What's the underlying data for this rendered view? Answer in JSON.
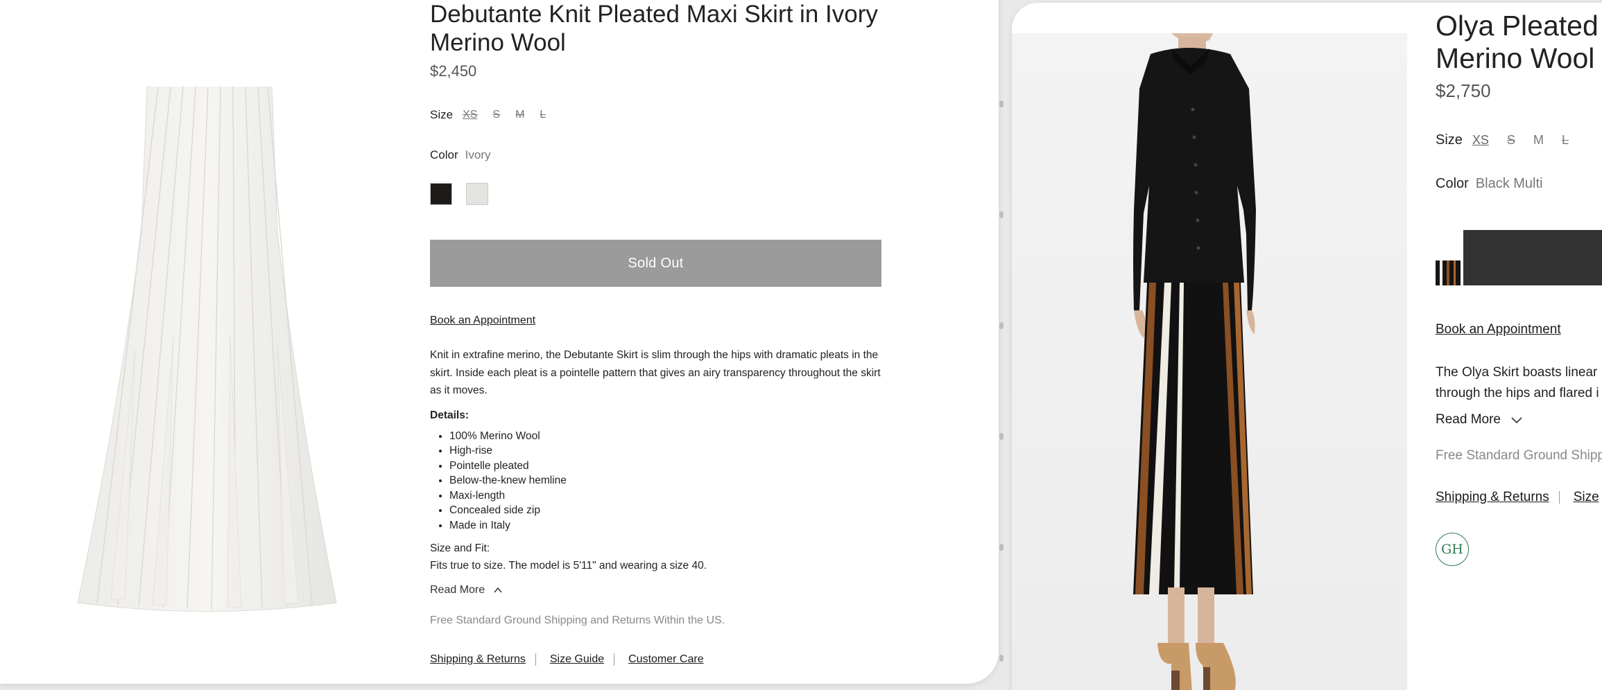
{
  "left_product": {
    "title": "Debutante Knit Pleated Maxi Skirt in Ivory Merino Wool",
    "price": "$2,450",
    "size_label": "Size",
    "sizes": [
      "XS",
      "S",
      "M",
      "L"
    ],
    "color_label": "Color",
    "color_value": "Ivory",
    "swatches": [
      {
        "name": "black",
        "color": "#1c1b1a"
      },
      {
        "name": "ivory",
        "color": "#e4e3df"
      }
    ],
    "button_label": "Sold Out",
    "book_link": "Book an Appointment",
    "description": "Knit in extrafine merino, the Debutante Skirt is slim through the hips with dramatic pleats in the skirt. Inside each pleat is a pointelle pattern that gives an airy transparency throughout the skirt as it moves.",
    "details_heading": "Details:",
    "details": [
      "100% Merino Wool",
      "High-rise",
      "Pointelle pleated",
      "Below-the-knew hemline",
      "Maxi-length",
      "Concealed side zip",
      "Made in Italy"
    ],
    "fit_heading": "Size and Fit:",
    "fit_text": "Fits true to size. The model is 5'11\" and wearing a size 40.",
    "read_more": "Read More",
    "shipping_note": "Free Standard Ground Shipping and Returns Within the US.",
    "footer_links": [
      "Shipping & Returns",
      "Size Guide",
      "Customer Care"
    ]
  },
  "right_product": {
    "title": "Olya Pleated r",
    "title_line2": "Merino Wool",
    "price": "$2,750",
    "size_label": "Size",
    "sizes": [
      "XS",
      "S",
      "M",
      "L"
    ],
    "color_label": "Color",
    "color_value": "Black Multi",
    "book_link": "Book an Appointment",
    "description_line1": "The Olya Skirt boasts linear",
    "description_line2": "through the hips and flared i",
    "read_more": "Read More",
    "shipping_note": "Free Standard Ground Shipp",
    "footer_links": [
      "Shipping & Returns",
      "Size"
    ],
    "logo_text": "GH"
  },
  "colors": {
    "sold_out_bg": "#9b9b9b",
    "add_button_bg": "#333333",
    "logo_green": "#2f7a4f"
  }
}
